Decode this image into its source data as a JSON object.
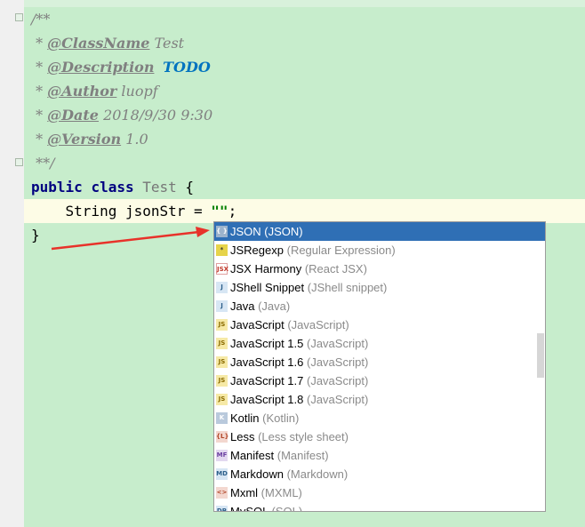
{
  "code": {
    "l1": "/**",
    "l2_prefix": " * ",
    "l2_tag": "@ClassName",
    "l2_val": " Test",
    "l3_prefix": " * ",
    "l3_tag": "@Description",
    "l3_val": "TODO",
    "l4_prefix": " * ",
    "l4_tag": "@Author",
    "l4_val": " luopf",
    "l5_prefix": " * ",
    "l5_tag": "@Date",
    "l5_val": " 2018/9/30 9:30",
    "l6_prefix": " * ",
    "l6_tag": "@Version",
    "l6_val": " 1.0",
    "l7": " **/",
    "l8_kw1": "public",
    "l8_kw2": "class",
    "l8_name": "Test",
    "l8_brace": " {",
    "l9_type": "    String jsonStr = ",
    "l9_str": "\"\"",
    "l9_end": ";",
    "l10": "}"
  },
  "completion": {
    "items": [
      {
        "name": "JSON",
        "type": "(JSON)",
        "icon": "json-icon",
        "selected": true
      },
      {
        "name": "JSRegexp",
        "type": "(Regular Expression)",
        "icon": "regexp-icon"
      },
      {
        "name": "JSX Harmony",
        "type": "(React JSX)",
        "icon": "jsx-icon"
      },
      {
        "name": "JShell Snippet",
        "type": "(JShell snippet)",
        "icon": "jshell-icon"
      },
      {
        "name": "Java",
        "type": "(Java)",
        "icon": "java-icon"
      },
      {
        "name": "JavaScript",
        "type": "(JavaScript)",
        "icon": "js-icon"
      },
      {
        "name": "JavaScript 1.5",
        "type": "(JavaScript)",
        "icon": "js-icon"
      },
      {
        "name": "JavaScript 1.6",
        "type": "(JavaScript)",
        "icon": "js-icon"
      },
      {
        "name": "JavaScript 1.7",
        "type": "(JavaScript)",
        "icon": "js-icon"
      },
      {
        "name": "JavaScript 1.8",
        "type": "(JavaScript)",
        "icon": "js-icon"
      },
      {
        "name": "Kotlin",
        "type": "(Kotlin)",
        "icon": "kotlin-icon"
      },
      {
        "name": "Less",
        "type": "(Less style sheet)",
        "icon": "less-icon"
      },
      {
        "name": "Manifest",
        "type": "(Manifest)",
        "icon": "manifest-icon"
      },
      {
        "name": "Markdown",
        "type": "(Markdown)",
        "icon": "markdown-icon"
      },
      {
        "name": "Mxml",
        "type": "(MXML)",
        "icon": "mxml-icon"
      },
      {
        "name": "MySQL",
        "type": "(SQL)",
        "icon": "mysql-icon"
      }
    ]
  },
  "colors": {
    "editor_bg": "#c7edcc",
    "selection": "#2f6fb5",
    "arrow": "#e8322a"
  }
}
